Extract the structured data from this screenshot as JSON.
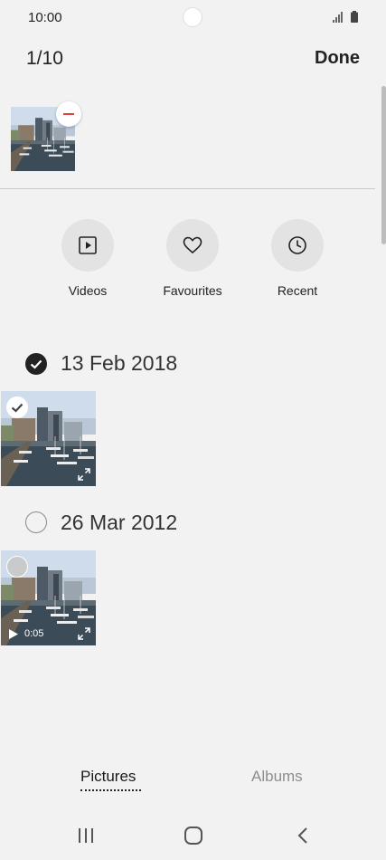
{
  "status_bar": {
    "time": "10:00"
  },
  "header": {
    "selection_count": "1/10",
    "done_label": "Done"
  },
  "categories": [
    {
      "label": "Videos",
      "icon": "video-play-icon"
    },
    {
      "label": "Favourites",
      "icon": "heart-icon"
    },
    {
      "label": "Recent",
      "icon": "clock-icon"
    }
  ],
  "groups": [
    {
      "date": "13 Feb 2018",
      "selected": true
    },
    {
      "date": "26 Mar 2012",
      "selected": false,
      "video_duration": "0:05"
    }
  ],
  "tabs": {
    "pictures": "Pictures",
    "albums": "Albums"
  },
  "colors": {
    "background": "#f2f2f2",
    "remove": "#e0413a",
    "check": "#222222"
  }
}
